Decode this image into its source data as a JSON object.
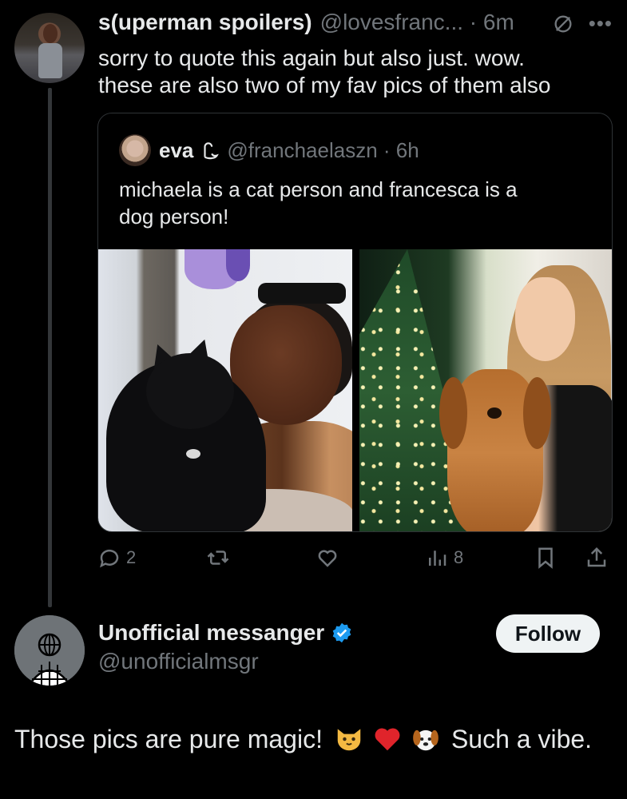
{
  "post": {
    "display_name": "s(uperman spoilers)",
    "meta": "@lovesfranc... · 6m",
    "text": "sorry to quote this again but also just. wow.\nthese are also two of my fav pics of them also"
  },
  "quote": {
    "display_name": "eva",
    "meta": "@franchaelaszn · 6h",
    "text": "michaela is a cat person and francesca is a\ndog person!"
  },
  "actions": {
    "replies": "2",
    "views": "8"
  },
  "suggested_user": {
    "display_name": "Unofficial messanger",
    "handle": "@unofficialmsgr",
    "follow_label": "Follow"
  },
  "comment": {
    "start": "Those pics are pure magic!",
    "end": "Such a vibe."
  },
  "icons": {
    "reply": "speech-bubble-icon",
    "repost": "repost-icon",
    "like": "heart-icon",
    "views": "bar-chart-icon",
    "bookmark": "bookmark-icon",
    "share": "share-icon",
    "verified": "verified-badge-icon",
    "more": "more-icon"
  },
  "colors": {
    "background": "#000000",
    "primary_text": "#e7e9ea",
    "secondary_text": "#71767b",
    "verified": "#1d9bf0",
    "follow_button": "#eff3f4"
  }
}
